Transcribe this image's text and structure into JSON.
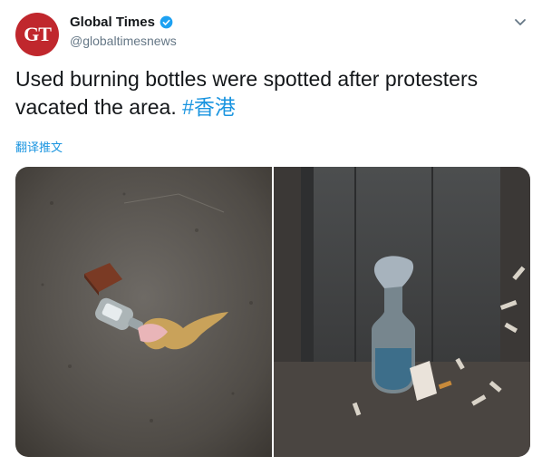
{
  "author": {
    "avatar_text": "GT",
    "display_name": "Global Times",
    "handle": "@globaltimesnews",
    "verified": true
  },
  "tweet": {
    "text": "Used burning bottles were spotted after protesters vacated the area.",
    "hashtag": "#香港",
    "translate_label": "翻译推文"
  },
  "media": {
    "images": [
      {
        "subject": "bottle-with-cloth-on-pavement"
      },
      {
        "subject": "bottle-with-rag-by-pillar"
      }
    ]
  },
  "icons": [
    "verified-badge-icon",
    "chevron-down-icon"
  ],
  "colors": {
    "accent": "#1b95e0",
    "avatar_bg": "#c0272d",
    "text": "#14171a",
    "secondary": "#657786"
  }
}
